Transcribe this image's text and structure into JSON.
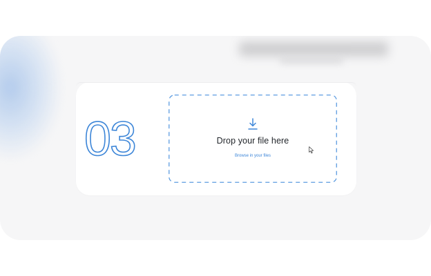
{
  "step": {
    "number": "03"
  },
  "dropzone": {
    "title": "Drop your file here",
    "browse_link": "Browse in your files",
    "icon": "download-icon"
  },
  "colors": {
    "accent": "#3d86d8",
    "dash_border": "#5b9be0",
    "panel_bg": "#f6f6f7",
    "card_bg": "#ffffff",
    "text_dark": "#1f2328"
  }
}
